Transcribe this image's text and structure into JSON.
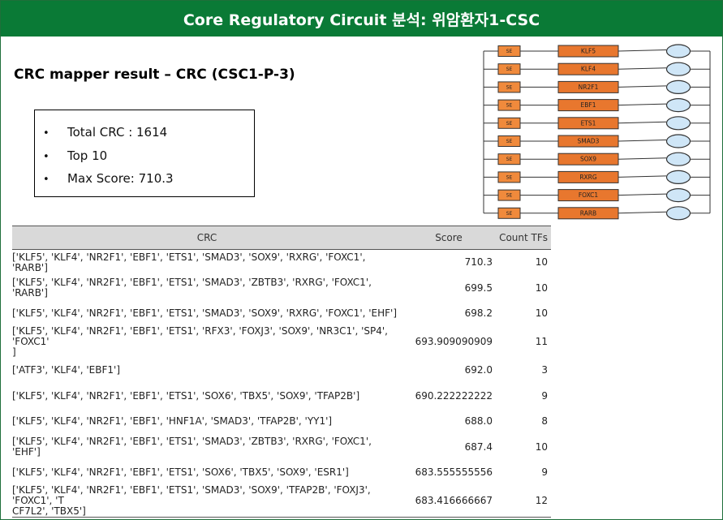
{
  "title": "Core Regulatory Circuit 분석: 위암환자1-CSC",
  "subtitle": "CRC mapper result – CRC (CSC1-P-3)",
  "summary": {
    "bullet": "•",
    "items": [
      "Total CRC : 1614",
      "Top 10",
      "Max Score: 710.3"
    ]
  },
  "diagram": {
    "se_label": "SE",
    "tfs": [
      "KLF5",
      "KLF4",
      "NR2F1",
      "EBF1",
      "ETS1",
      "SMAD3",
      "SOX9",
      "RXRG",
      "FOXC1",
      "RARB"
    ],
    "colors": {
      "se_fill": "#f08a3c",
      "tf_fill": "#e8772e",
      "node_fill": "#cfe6f7",
      "border": "#333333"
    }
  },
  "table": {
    "headers": {
      "crc": "CRC",
      "score": "Score",
      "count": "Count TFs"
    },
    "rows": [
      {
        "crc": "['KLF5', 'KLF4', 'NR2F1', 'EBF1', 'ETS1', 'SMAD3', 'SOX9', 'RXRG', 'FOXC1', 'RARB']",
        "score": "710.3",
        "count": "10"
      },
      {
        "crc": "['KLF5', 'KLF4', 'NR2F1', 'EBF1', 'ETS1', 'SMAD3', 'ZBTB3', 'RXRG', 'FOXC1', 'RARB']",
        "score": "699.5",
        "count": "10"
      },
      {
        "crc": "['KLF5', 'KLF4', 'NR2F1', 'EBF1', 'ETS1', 'SMAD3', 'SOX9', 'RXRG', 'FOXC1', 'EHF']",
        "score": "698.2",
        "count": "10"
      },
      {
        "crc": "['KLF5', 'KLF4', 'NR2F1', 'EBF1', 'ETS1', 'RFX3', 'FOXJ3', 'SOX9', 'NR3C1', 'SP4', 'FOXC1'\n]",
        "score": "693.909090909",
        "count": "11"
      },
      {
        "crc": "['ATF3', 'KLF4', 'EBF1']",
        "score": "692.0",
        "count": "3"
      },
      {
        "crc": "['KLF5', 'KLF4', 'NR2F1', 'EBF1', 'ETS1', 'SOX6', 'TBX5', 'SOX9', 'TFAP2B']",
        "score": "690.222222222",
        "count": "9"
      },
      {
        "crc": "['KLF5', 'KLF4', 'NR2F1', 'EBF1', 'HNF1A', 'SMAD3', 'TFAP2B', 'YY1']",
        "score": "688.0",
        "count": "8"
      },
      {
        "crc": "['KLF5', 'KLF4', 'NR2F1', 'EBF1', 'ETS1', 'SMAD3', 'ZBTB3', 'RXRG', 'FOXC1', 'EHF']",
        "score": "687.4",
        "count": "10"
      },
      {
        "crc": "['KLF5', 'KLF4', 'NR2F1', 'EBF1', 'ETS1', 'SOX6', 'TBX5', 'SOX9', 'ESR1']",
        "score": "683.555555556",
        "count": "9"
      },
      {
        "crc": "['KLF5', 'KLF4', 'NR2F1', 'EBF1', 'ETS1', 'SMAD3', 'SOX9', 'TFAP2B', 'FOXJ3', 'FOXC1', 'T\nCF7L2', 'TBX5']",
        "score": "683.416666667",
        "count": "12"
      }
    ]
  }
}
